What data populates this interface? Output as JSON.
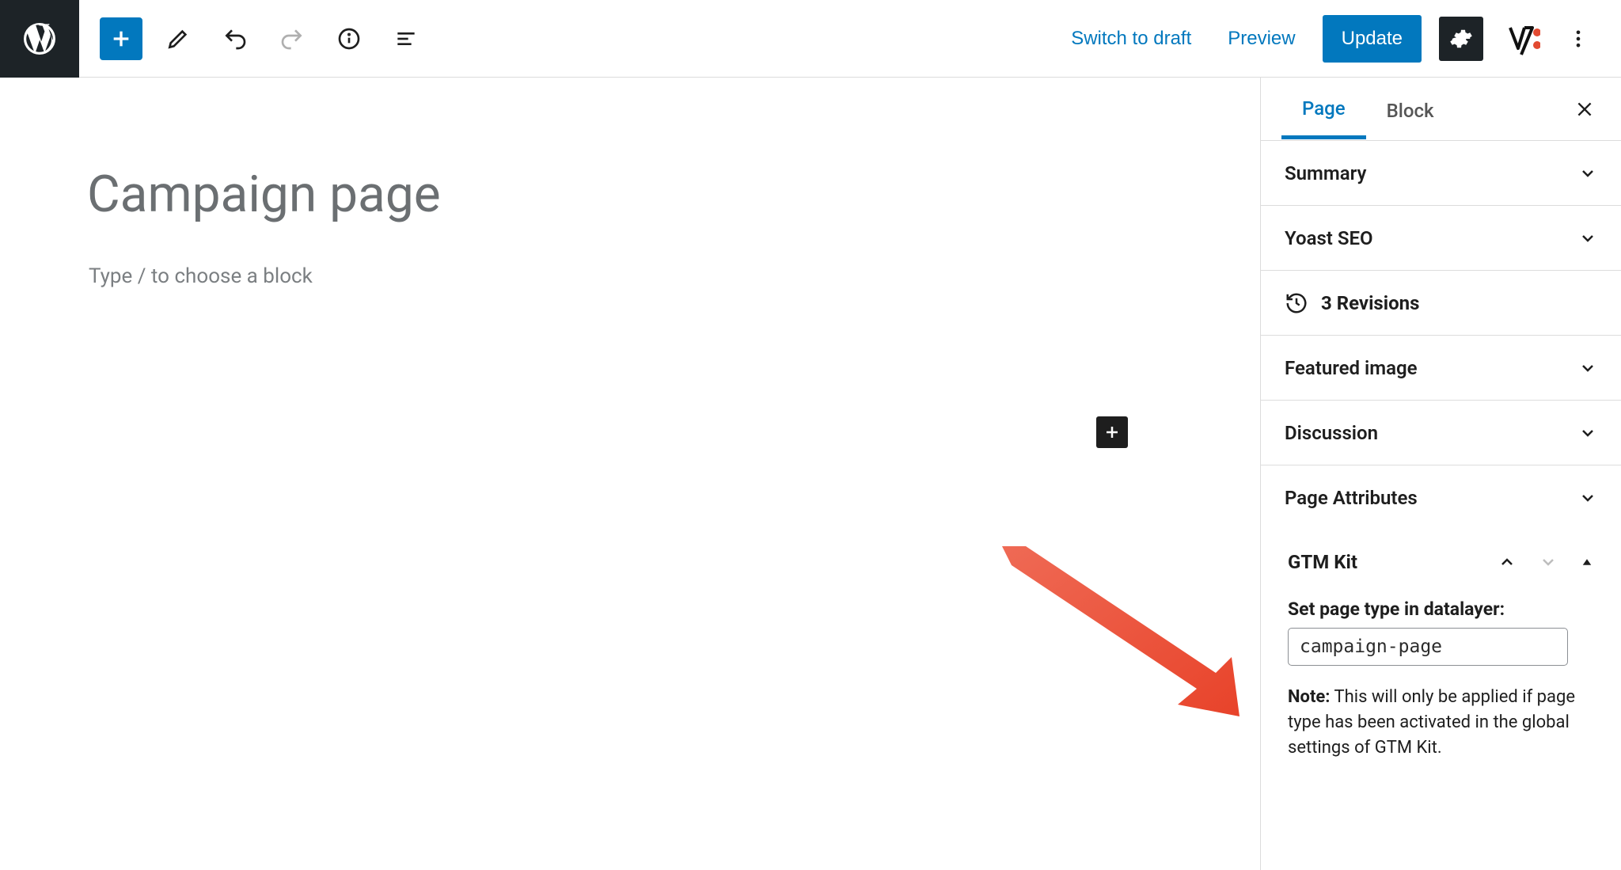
{
  "toolbar": {
    "switch_to_draft": "Switch to draft",
    "preview": "Preview",
    "update": "Update"
  },
  "editor": {
    "page_title": "Campaign page",
    "block_placeholder": "Type / to choose a block"
  },
  "sidebar": {
    "tabs": {
      "page": "Page",
      "block": "Block"
    },
    "panels": {
      "summary": "Summary",
      "yoast": "Yoast SEO",
      "revisions": "3 Revisions",
      "featured_image": "Featured image",
      "discussion": "Discussion",
      "page_attributes": "Page Attributes"
    },
    "gtm": {
      "title": "GTM Kit",
      "field_label": "Set page type in datalayer:",
      "field_value": "campaign-page",
      "note_label": "Note:",
      "note_text": " This will only be applied if page type has been activated in the global settings of GTM Kit."
    }
  }
}
